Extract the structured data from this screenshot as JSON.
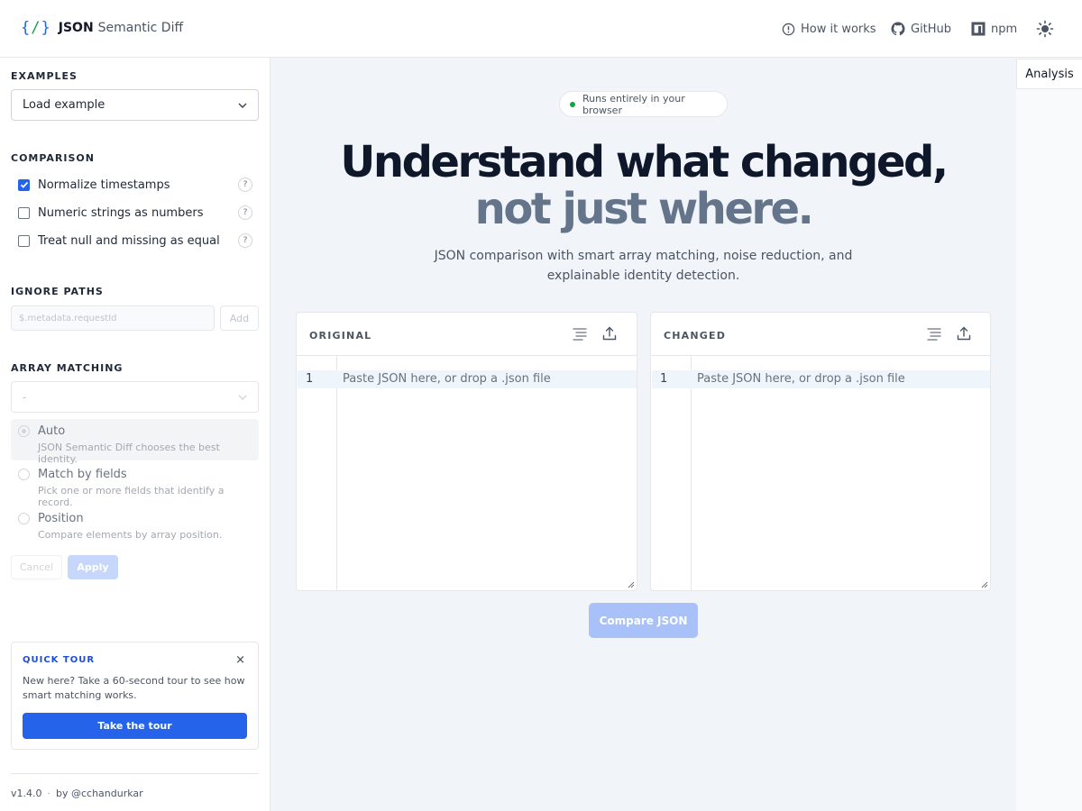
{
  "header": {
    "logo_icon": "{/}",
    "logo_strong": "JSON",
    "logo_rest": "Semantic Diff",
    "nav": {
      "how": "How it works",
      "github": "GitHub",
      "npm": "npm"
    },
    "theme_icon": "sun-icon"
  },
  "sidebar": {
    "examples_title": "EXAMPLES",
    "examples_select": "Load example",
    "comparison_title": "COMPARISON",
    "options": [
      {
        "label": "Normalize timestamps",
        "checked": true
      },
      {
        "label": "Numeric strings as numbers",
        "checked": false
      },
      {
        "label": "Treat null and missing as equal",
        "checked": false
      }
    ],
    "help_mark": "?",
    "ignore_title": "IGNORE PATHS",
    "ignore_placeholder": "$.metadata.requestId",
    "add_label": "Add",
    "array_title": "ARRAY MATCHING",
    "array_select": "-",
    "radios": [
      {
        "label": "Auto",
        "desc": "JSON Semantic Diff chooses the best identity.",
        "selected": true
      },
      {
        "label": "Match by fields",
        "desc": "Pick one or more fields that identify a record.",
        "selected": false
      },
      {
        "label": "Position",
        "desc": "Compare elements by array position.",
        "selected": false
      }
    ],
    "cancel_label": "Cancel",
    "apply_label": "Apply",
    "tour": {
      "title": "QUICK TOUR",
      "close": "×",
      "text": "New here? Take a 60-second tour to see how smart matching works.",
      "button": "Take the tour"
    },
    "footer": {
      "version": "v1.4.0",
      "sep": "·",
      "author": "by @cchandurkar"
    }
  },
  "main": {
    "badge": "Runs entirely in your browser",
    "headline_1": "Understand what changed,",
    "headline_2": "not just where.",
    "subtitle": "JSON comparison with smart array matching, noise reduction, and explainable identity detection.",
    "left_panel": {
      "label": "ORIGINAL",
      "line_no": "1",
      "placeholder": "Paste JSON here, or drop a .json file"
    },
    "right_panel": {
      "label": "CHANGED",
      "line_no": "1",
      "placeholder": "Paste JSON here, or drop a .json file"
    },
    "compare_label": "Compare JSON"
  },
  "rail": {
    "analysis_tab": "Analysis"
  },
  "colors": {
    "accent": "#2563eb",
    "status_green": "#16a34a",
    "headline": "#0f172a",
    "headline_muted": "#64748b",
    "main_bg": "#f1f4f9"
  }
}
